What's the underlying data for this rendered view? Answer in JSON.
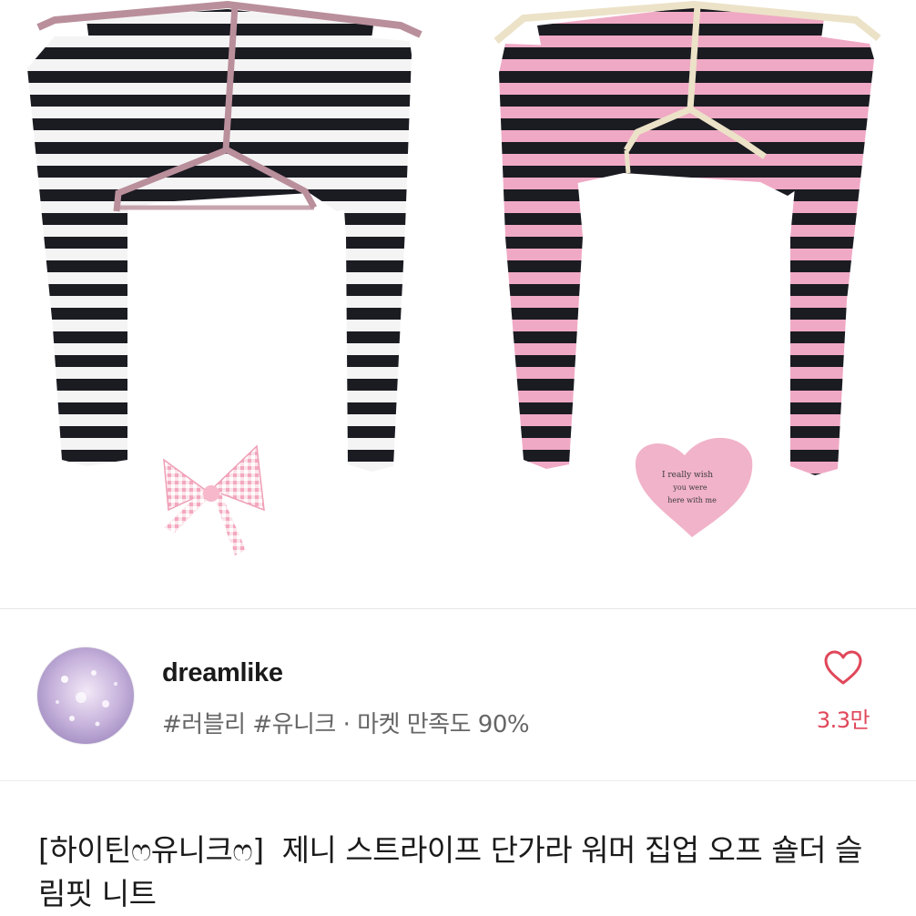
{
  "seller": {
    "name": "dreamlike",
    "tags": "#러블리 #유니크 · 마켓 만족도 90%"
  },
  "like": {
    "count": "3.3만",
    "icon": "heart-outline-icon",
    "color": "#e0475a"
  },
  "product": {
    "title": "[하이틴ෆ유니크ෆ]  제니 스트라이프 단가라 워머 집업 오프 숄더 슬림핏 니트",
    "heart_card_text": [
      "I really wish",
      "you were",
      "here with me"
    ],
    "colors": {
      "stripe_dark": "#1b1b22",
      "stripe_white": "#f4f4f4",
      "stripe_pink": "#efa9c4",
      "trim_mauve": "#b98f9b",
      "trim_cream": "#ece2c8",
      "bow_pink": "#f7c9d6",
      "card_pink": "#f1b3c9"
    }
  }
}
